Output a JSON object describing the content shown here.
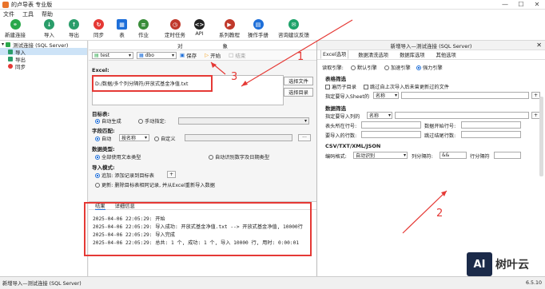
{
  "window": {
    "title": "的卢导表 专业版",
    "controls": [
      "—",
      "☐",
      "✕"
    ]
  },
  "menu": [
    "文件",
    "工具",
    "帮助"
  ],
  "toolbar": [
    {
      "label": "新建连接",
      "icon": "link-icon",
      "color": "#2aa84a",
      "glyph": "⚭"
    },
    {
      "label": "导入",
      "icon": "import-icon",
      "color": "#2a9d6a",
      "glyph": "↓"
    },
    {
      "label": "导出",
      "icon": "export-icon",
      "color": "#2a9d6a",
      "glyph": "↑"
    },
    {
      "label": "同步",
      "icon": "sync-icon",
      "color": "#e53935",
      "glyph": "↻"
    },
    {
      "label": "表",
      "icon": "table-icon",
      "color": "#1e6fd9",
      "glyph": "▦"
    },
    {
      "label": "作业",
      "icon": "job-icon",
      "color": "#3a8d3a",
      "glyph": "≡"
    },
    {
      "label": "定时任务",
      "icon": "timer-icon",
      "color": "#c0392b",
      "glyph": "◷"
    },
    {
      "label": "API",
      "icon": "api-icon",
      "color": "#222222",
      "glyph": "<>"
    },
    {
      "label": "系列教程",
      "icon": "tutorial-icon",
      "color": "#c0392b",
      "glyph": "▶"
    },
    {
      "label": "操作手册",
      "icon": "manual-icon",
      "color": "#1e6fd9",
      "glyph": "▤"
    },
    {
      "label": "咨询建议反馈",
      "icon": "chat-icon",
      "color": "#1ea36a",
      "glyph": "✉"
    }
  ],
  "tree": {
    "root": "测试连接 (SQL Server)",
    "items": [
      "导入",
      "导出",
      "同步"
    ]
  },
  "main": {
    "tabs": [
      "对",
      "象"
    ],
    "db_select": "test",
    "schema_select": "dbo",
    "save": "保存",
    "start": "开始",
    "stop": "结束",
    "excel_label": "Excel:",
    "file_path": "D:/数据/多个列分隔符/开放式基金净值.txt",
    "choose_file": "选择文件",
    "choose_dir": "选择目录",
    "target_label": "目标表:",
    "auto_gen": "自动生成",
    "manual": "手动指定:",
    "field_match_label": "字段匹配:",
    "auto": "自动",
    "by_name": "按名称",
    "custom": "自定义",
    "dtype_label": "数据类型:",
    "all_text": "全部使用文本类型",
    "auto_detect": "自动识别数字及日期类型",
    "import_mode_label": "导入模式:",
    "append": "追加: 添加记录到目标表",
    "update": "更新: 删除目标表相同记录, 并从Excel重新导入数据"
  },
  "log": {
    "tabs": [
      "结果",
      "详细信息"
    ],
    "lines": [
      "2025-04-06 22:05:29: 开始",
      "2025-04-06 22:05:29: 导入成功: 开放式基金净值.txt --> 开放式基金净值, 10000行",
      "2025-04-06 22:05:29: 导入完成",
      "2025-04-06 22:05:29: 总共: 1 个, 成功: 1 个, 导入 10000 行, 用时: 0:00:01"
    ]
  },
  "dialog": {
    "title": "新增导入—测试连接 (SQL Server)",
    "tabs": [
      "Excel选项",
      "数据清洗选项",
      "数据库选项",
      "其他选项"
    ],
    "engine_label": "读取引擎:",
    "engines": [
      "默认引擎",
      "加速引擎",
      "强力引擎"
    ],
    "sheet_section": "表格筛选",
    "traverse_sub": "遍历子目录",
    "skip_unchanged": "跳过自上次导入后未曾更新过的文件",
    "sheet_label": "指定要导入Sheet的",
    "sheet_by": "名称",
    "data_section": "数据筛选",
    "cols_label": "指定要导入列的",
    "cols_by": "名称",
    "header_row": "表头所在行号:",
    "data_start": "数据开始行号:",
    "rows_count": "要导入的行数:",
    "skip_tail": "跳过结尾行数:",
    "csv_section": "CSV/TXT/XML/JSON",
    "encoding_label": "编码格式:",
    "encoding_value": "自动识别",
    "col_sep_label": "列分隔符:",
    "col_sep_value": "&&",
    "row_sep_label": "行分隔符"
  },
  "annotations": [
    "1",
    "2",
    "3"
  ],
  "statusbar": {
    "left": "新增导入—测试连接 (SQL Server)",
    "version": "6.5.10"
  },
  "watermark": {
    "text": "树叶云"
  }
}
